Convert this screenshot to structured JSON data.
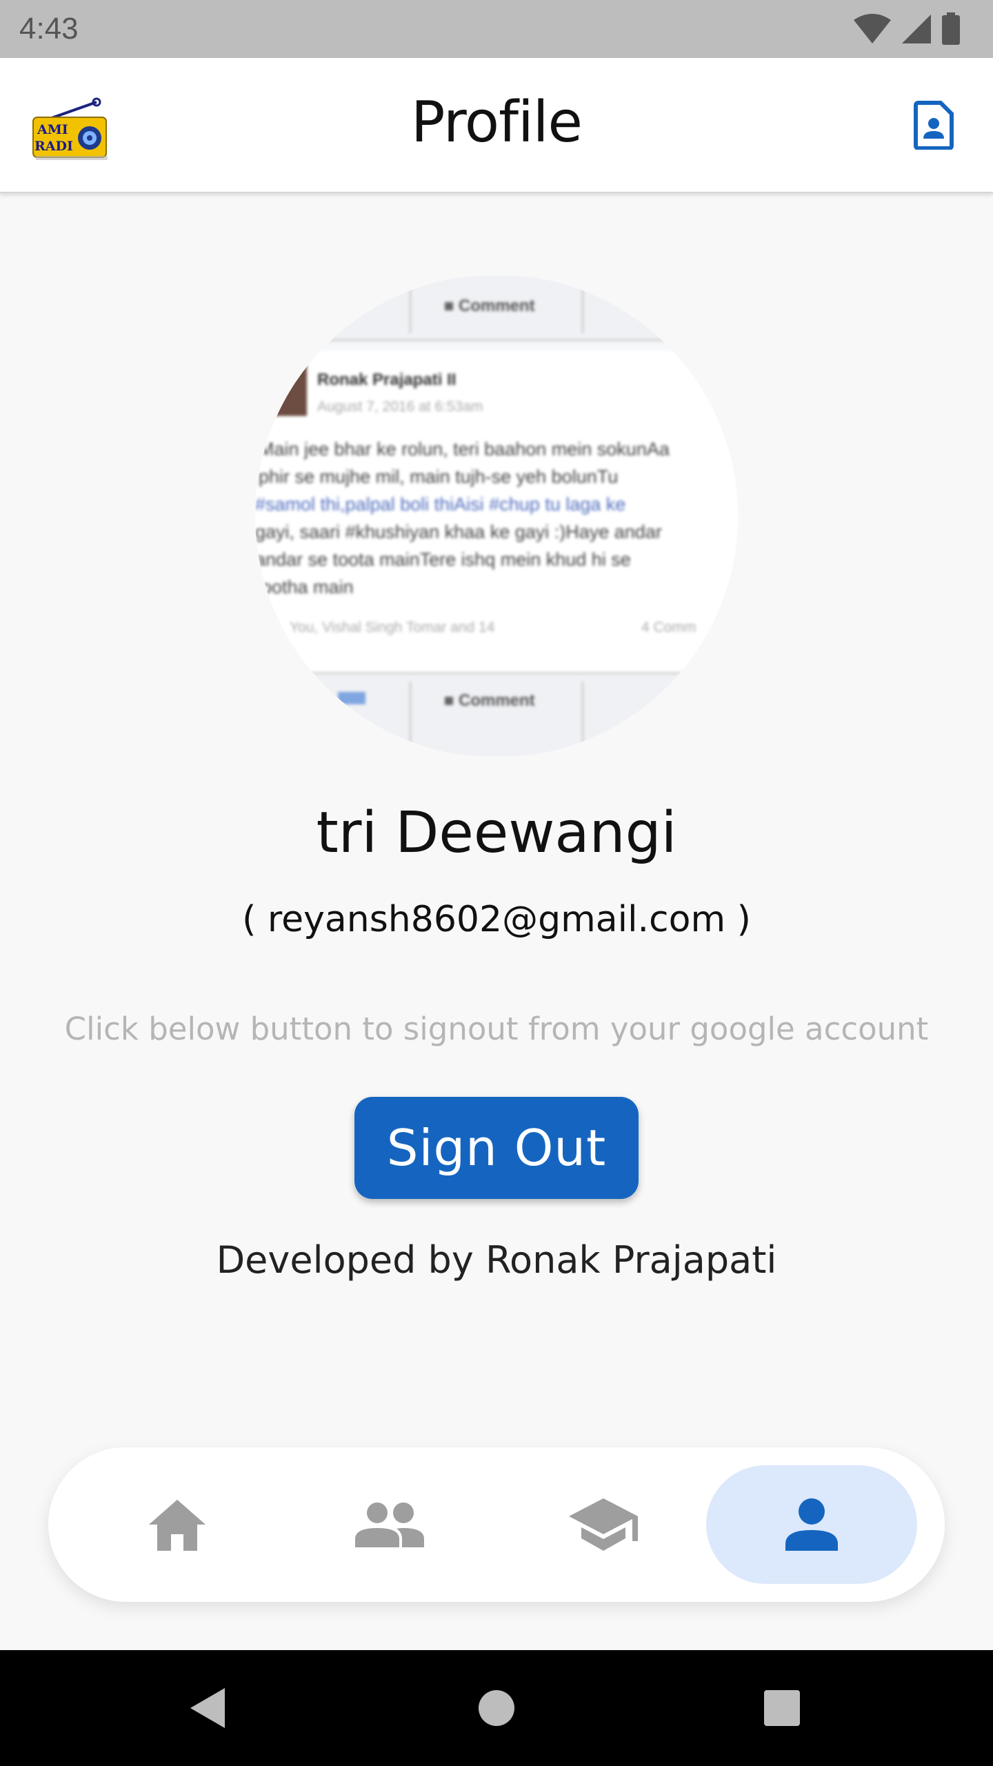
{
  "status_bar": {
    "time": "4:43"
  },
  "app_bar": {
    "title": "Profile",
    "logo_text_top": "AMI",
    "logo_text_bottom": "RADI"
  },
  "profile": {
    "name": "tri Deewangi",
    "email": "( reyansh8602@gmail.com )",
    "hint": "Click below button to signout from your google account",
    "signout_label": "Sign Out",
    "credit": "Developed by Ronak Prajapati"
  },
  "avatar_image": {
    "comment_label": "Comment",
    "poster_name": "Ronak Prajapati II",
    "post_date": "August 7, 2016 at 6:53am",
    "post_lines": [
      "Main jee bhar ke rolun, teri baahon mein sokunAa",
      "phir se mujhe mil, main tujh-se yeh bolunTu",
      "#samol thi,palpal boli thiAisi #chup tu laga ke",
      "gayi, saari #khushiyan khaa ke gayi :)Haye andar",
      "andar se toota mainTere ishq mein khud hi se",
      "rootha main"
    ],
    "reactions": "You, Vishal Singh Tomar and 14",
    "comments_count": "4 Comm"
  },
  "bottom_nav": {
    "items": [
      {
        "name": "home",
        "icon": "home-icon",
        "active": false
      },
      {
        "name": "people",
        "icon": "people-icon",
        "active": false
      },
      {
        "name": "school",
        "icon": "school-icon",
        "active": false
      },
      {
        "name": "profile",
        "icon": "person-icon",
        "active": true
      }
    ]
  },
  "colors": {
    "primary": "#1565c0",
    "nav_active_bg": "#dce8fb",
    "inactive_icon": "#9e9e9e",
    "background": "#f8f8f8"
  }
}
